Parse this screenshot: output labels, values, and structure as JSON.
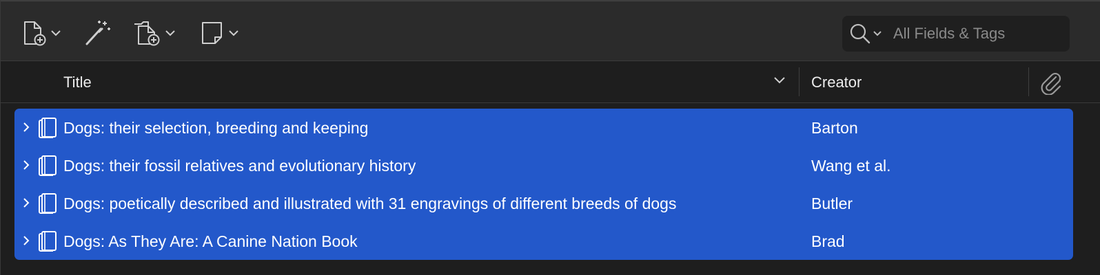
{
  "toolbar": {
    "new_item_icon": "new-document-icon",
    "add_by_identifier_icon": "magic-wand-icon",
    "add_attachment_icon": "add-attachment-icon",
    "new_note_icon": "note-icon",
    "search": {
      "icon": "search-icon",
      "placeholder": "All Fields & Tags",
      "value": ""
    }
  },
  "columns": {
    "title": "Title",
    "creator": "Creator",
    "attachments_icon": "paperclip-icon"
  },
  "colors": {
    "selection": "#2358ca",
    "toolbar_bg": "#2b2b2b",
    "list_bg": "#1e1e1e"
  },
  "items": [
    {
      "title": "Dogs: their selection, breeding and keeping",
      "creator": "Barton",
      "icon": "book-icon"
    },
    {
      "title": "Dogs: their fossil relatives and evolutionary history",
      "creator": "Wang et al.",
      "icon": "book-icon"
    },
    {
      "title": "Dogs: poetically described and illustrated with 31 engravings of different breeds of dogs",
      "creator": "Butler",
      "icon": "book-icon"
    },
    {
      "title": "Dogs: As They Are: A Canine Nation Book",
      "creator": "Brad",
      "icon": "book-icon"
    }
  ]
}
